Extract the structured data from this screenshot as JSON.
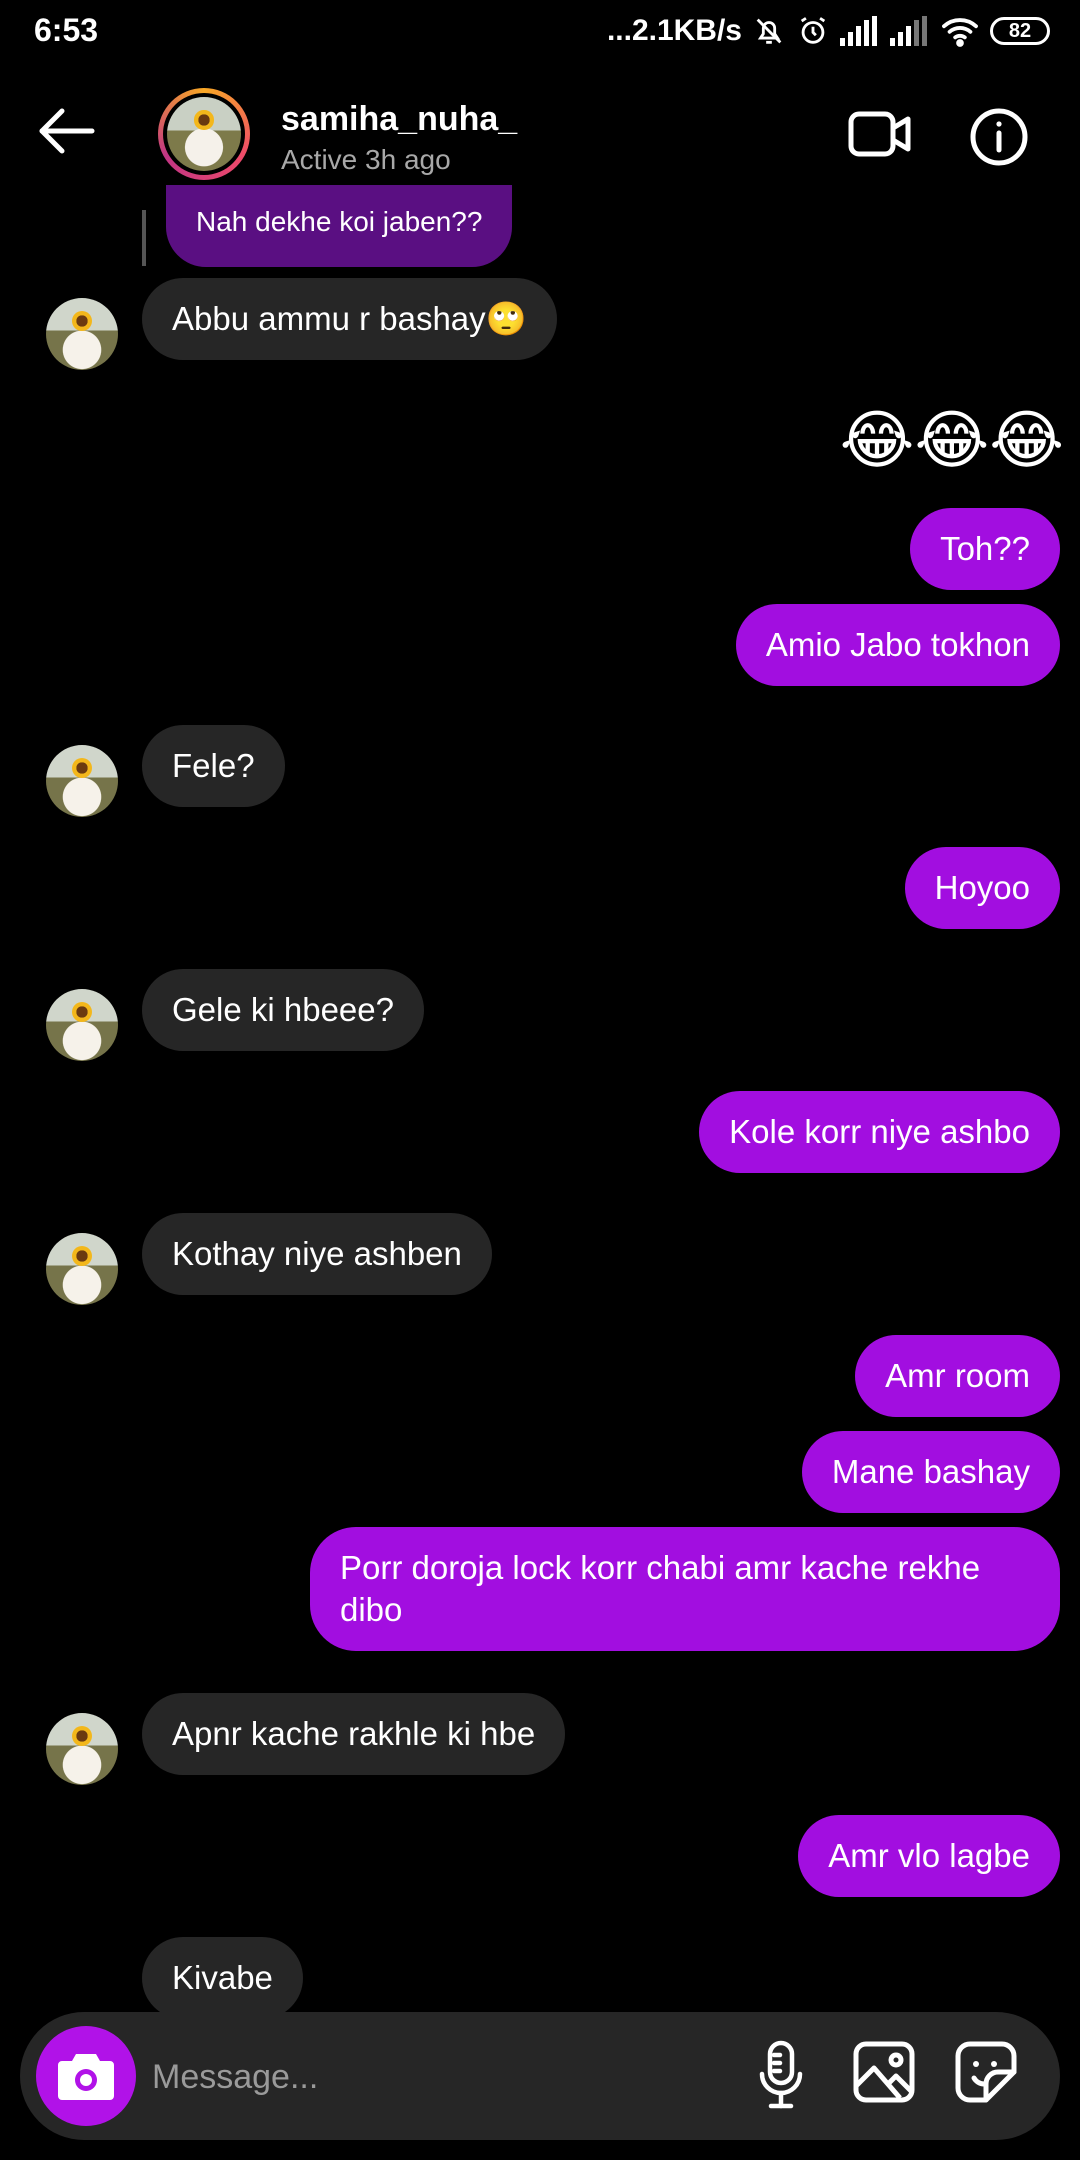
{
  "status_bar": {
    "time": "6:53",
    "network_speed": "...2.1KB/s",
    "battery": "82",
    "icons": [
      "mute-icon",
      "alarm-icon",
      "signal-icon",
      "signal-icon",
      "wifi-icon",
      "battery-icon"
    ]
  },
  "header": {
    "username": "samiha_nuha_",
    "status": "Active 3h ago",
    "icons": [
      "back-arrow-icon",
      "video-call-icon",
      "info-icon"
    ]
  },
  "reply_preview": {
    "text": "Nah dekhe koi jaben??"
  },
  "messages": [
    {
      "from": "them",
      "text": "Abbu ammu r bashay🙄"
    },
    {
      "from": "me",
      "text": "😂😂😂"
    },
    {
      "from": "me",
      "text": "Toh??"
    },
    {
      "from": "me",
      "text": "Amio Jabo tokhon"
    },
    {
      "from": "them",
      "text": "Fele?"
    },
    {
      "from": "me",
      "text": "Hoyoo"
    },
    {
      "from": "them",
      "text": "Gele ki hbeee?"
    },
    {
      "from": "me",
      "text": "Kole korr niye ashbo"
    },
    {
      "from": "them",
      "text": "Kothay niye ashben"
    },
    {
      "from": "me",
      "text": "Amr room"
    },
    {
      "from": "me",
      "text": "Mane bashay"
    },
    {
      "from": "me",
      "text": "Porr doroja lock korr chabi amr kache rekhe dibo"
    },
    {
      "from": "them",
      "text": "Apnr kache rakhle ki hbe"
    },
    {
      "from": "me",
      "text": "Amr vlo lagbe"
    },
    {
      "from": "them",
      "text": "Kivabe"
    }
  ],
  "composer": {
    "placeholder": "Message...",
    "icons": [
      "camera-icon",
      "microphone-icon",
      "gallery-icon",
      "sticker-icon"
    ]
  },
  "colors": {
    "outgoing_bubble": "#a20ee0",
    "incoming_bubble": "#262626",
    "camera_button": "#b112e8",
    "background": "#000000"
  }
}
